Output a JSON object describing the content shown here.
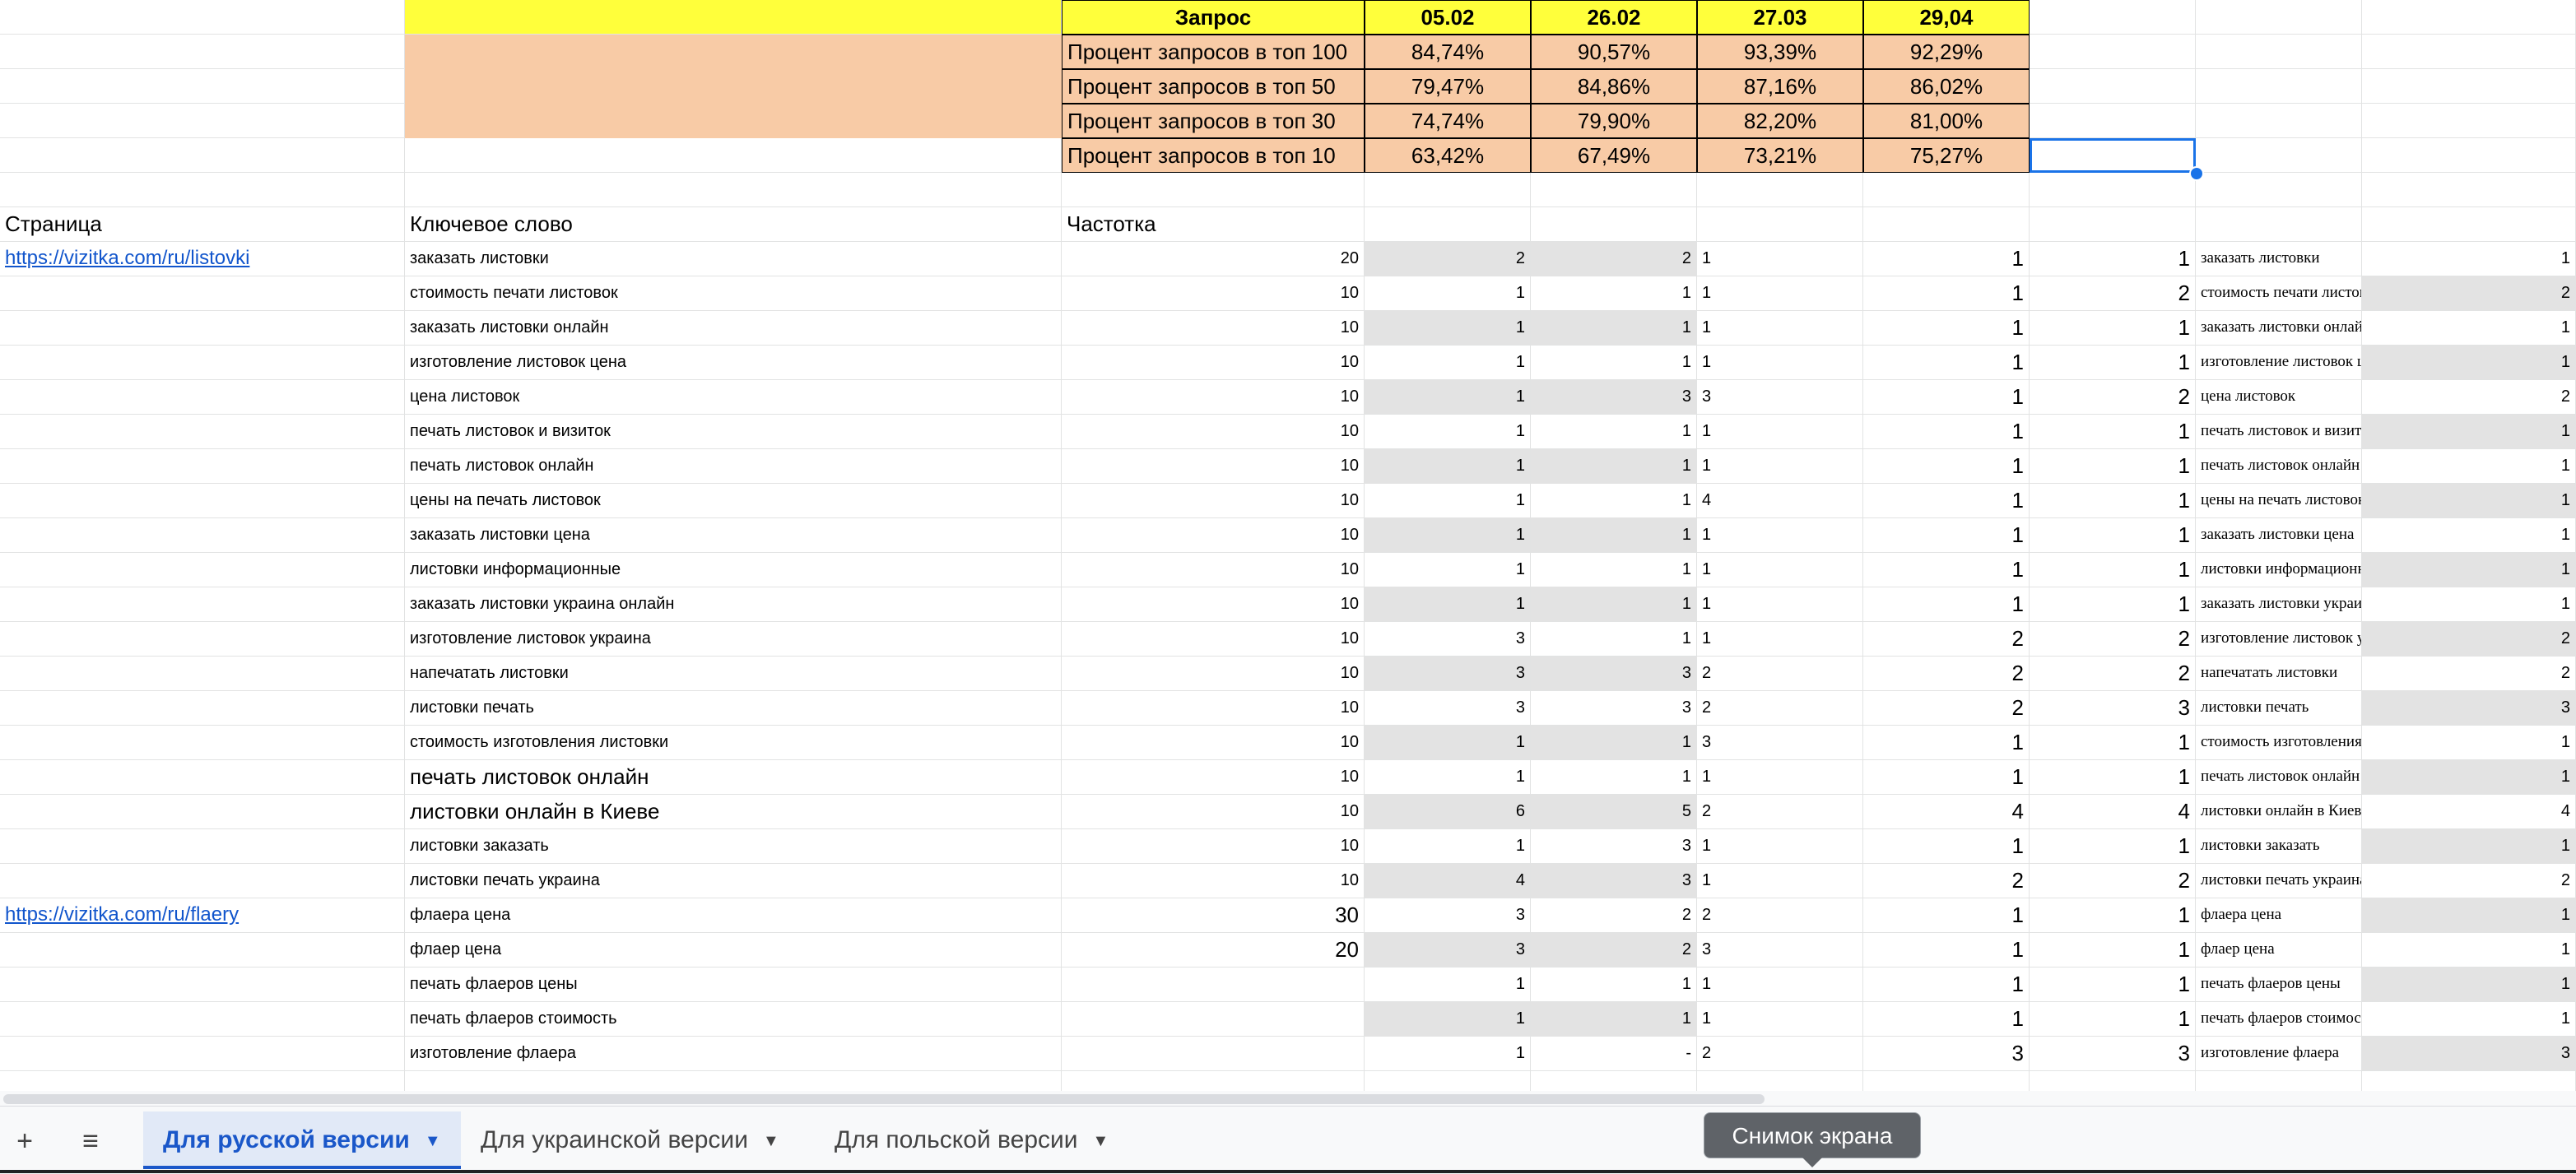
{
  "summary": {
    "header_label": "Запрос",
    "dates": [
      "05.02",
      "26.02",
      "27.03",
      "29,04"
    ],
    "rows": [
      {
        "label": "Процент запросов в топ 100",
        "values": [
          "84,74%",
          "90,57%",
          "93,39%",
          "92,29%"
        ]
      },
      {
        "label": "Процент запросов в топ 50",
        "values": [
          "79,47%",
          "84,86%",
          "87,16%",
          "86,02%"
        ]
      },
      {
        "label": "Процент запросов в топ 30",
        "values": [
          "74,74%",
          "79,90%",
          "82,20%",
          "81,00%"
        ]
      },
      {
        "label": "Процент запросов в топ 10",
        "values": [
          "63,42%",
          "67,49%",
          "73,21%",
          "75,27%"
        ]
      }
    ]
  },
  "columns": {
    "page": "Страница",
    "keyword": "Ключевое слово",
    "frequency": "Частотка"
  },
  "rows": [
    {
      "page": "https://vizitka.com/ru/listovki",
      "kw": "заказать листовки",
      "freq": "20",
      "d1": "2",
      "d2": "2",
      "d3": "1",
      "d4": "1",
      "e": "1",
      "kw2": "заказать листовки",
      "v2": "1"
    },
    {
      "page": "",
      "kw": "стоимость печати листовок",
      "freq": "10",
      "d1": "1",
      "d2": "1",
      "d3": "1",
      "d4": "1",
      "e": "2",
      "kw2": "стоимость печати листовок",
      "v2": "2"
    },
    {
      "page": "",
      "kw": "заказать листовки онлайн",
      "freq": "10",
      "d1": "1",
      "d2": "1",
      "d3": "1",
      "d4": "1",
      "e": "1",
      "kw2": "заказать листовки онлайн",
      "v2": "1"
    },
    {
      "page": "",
      "kw": "изготовление листовок цена",
      "freq": "10",
      "d1": "1",
      "d2": "1",
      "d3": "1",
      "d4": "1",
      "e": "1",
      "kw2": "изготовление листовок цена",
      "v2": "1"
    },
    {
      "page": "",
      "kw": "цена листовок",
      "freq": "10",
      "d1": "1",
      "d2": "3",
      "d3": "3",
      "d4": "1",
      "e": "2",
      "kw2": "цена листовок",
      "v2": "2"
    },
    {
      "page": "",
      "kw": "печать листовок и визиток",
      "freq": "10",
      "d1": "1",
      "d2": "1",
      "d3": "1",
      "d4": "1",
      "e": "1",
      "kw2": "печать листовок и визиток",
      "v2": "1"
    },
    {
      "page": "",
      "kw": "печать листовок онлайн",
      "freq": "10",
      "d1": "1",
      "d2": "1",
      "d3": "1",
      "d4": "1",
      "e": "1",
      "kw2": "печать листовок онлайн",
      "v2": "1"
    },
    {
      "page": "",
      "kw": "цены на печать листовок",
      "freq": "10",
      "d1": "1",
      "d2": "1",
      "d3": "4",
      "d4": "1",
      "e": "1",
      "kw2": "цены на печать листовок",
      "v2": "1"
    },
    {
      "page": "",
      "kw": "заказать листовки цена",
      "freq": "10",
      "d1": "1",
      "d2": "1",
      "d3": "1",
      "d4": "1",
      "e": "1",
      "kw2": "заказать листовки цена",
      "v2": "1"
    },
    {
      "page": "",
      "kw": "листовки информационные",
      "freq": "10",
      "d1": "1",
      "d2": "1",
      "d3": "1",
      "d4": "1",
      "e": "1",
      "kw2": "листовки информационные",
      "v2": "1"
    },
    {
      "page": "",
      "kw": "заказать листовки украина онлайн",
      "freq": "10",
      "d1": "1",
      "d2": "1",
      "d3": "1",
      "d4": "1",
      "e": "1",
      "kw2": "заказать листовки украина онлайн",
      "v2": "1"
    },
    {
      "page": "",
      "kw": "изготовление листовок украина",
      "freq": "10",
      "d1": "3",
      "d2": "1",
      "d3": "1",
      "d4": "2",
      "e": "2",
      "kw2": "изготовление листовок украина",
      "v2": "2"
    },
    {
      "page": "",
      "kw": "напечатать листовки",
      "freq": "10",
      "d1": "3",
      "d2": "3",
      "d3": "2",
      "d4": "2",
      "e": "2",
      "kw2": "напечатать листовки",
      "v2": "2"
    },
    {
      "page": "",
      "kw": "листовки печать",
      "freq": "10",
      "d1": "3",
      "d2": "3",
      "d3": "2",
      "d4": "2",
      "e": "3",
      "kw2": "листовки печать",
      "v2": "3"
    },
    {
      "page": "",
      "kw": "стоимость изготовления листовки",
      "freq": "10",
      "d1": "1",
      "d2": "1",
      "d3": "3",
      "d4": "1",
      "e": "1",
      "kw2": "стоимость изготовления листовки",
      "v2": "1"
    },
    {
      "page": "",
      "kw": "печать листовок онлайн",
      "freq": "10",
      "d1": "1",
      "d2": "1",
      "d3": "1",
      "d4": "1",
      "e": "1",
      "kw2": "печать листовок онлайн",
      "v2": "1"
    },
    {
      "page": "",
      "kw": "листовки онлайн в Киеве",
      "freq": "10",
      "d1": "6",
      "d2": "5",
      "d3": "2",
      "d4": "4",
      "e": "4",
      "kw2": "листовки онлайн в Киеве",
      "v2": "4"
    },
    {
      "page": "",
      "kw": "листовки заказать",
      "freq": "10",
      "d1": "1",
      "d2": "3",
      "d3": "1",
      "d4": "1",
      "e": "1",
      "kw2": "листовки заказать",
      "v2": "1"
    },
    {
      "page": "",
      "kw": "листовки печать украина",
      "freq": "10",
      "d1": "4",
      "d2": "3",
      "d3": "1",
      "d4": "2",
      "e": "2",
      "kw2": "листовки печать украина",
      "v2": "2"
    },
    {
      "page": "https://vizitka.com/ru/flaery",
      "kw": "флаера цена",
      "freq": "30",
      "d1": "3",
      "d2": "2",
      "d3": "2",
      "d4": "1",
      "e": "1",
      "kw2": "флаера цена",
      "v2": "1"
    },
    {
      "page": "",
      "kw": "флаер цена",
      "freq": "20",
      "d1": "3",
      "d2": "2",
      "d3": "3",
      "d4": "1",
      "e": "1",
      "kw2": "флаер цена",
      "v2": "1"
    },
    {
      "page": "",
      "kw": "печать флаеров цены",
      "freq": "",
      "d1": "1",
      "d2": "1",
      "d3": "1",
      "d4": "1",
      "e": "1",
      "kw2": "печать флаеров цены",
      "v2": "1"
    },
    {
      "page": "",
      "kw": "печать флаеров стоимость",
      "freq": "",
      "d1": "1",
      "d2": "1",
      "d3": "1",
      "d4": "1",
      "e": "1",
      "kw2": "печать флаеров стоимость",
      "v2": "1"
    },
    {
      "page": "",
      "kw": "изготовление флаера",
      "freq": "",
      "d1": "1",
      "d2": "-",
      "d3": "2",
      "d4": "3",
      "e": "3",
      "kw2": "изготовление флаера",
      "v2": "3"
    }
  ],
  "tabs": [
    {
      "label": "Для русской версии"
    },
    {
      "label": "Для украинской версии"
    },
    {
      "label": "Для польской версии"
    }
  ],
  "tooltip": "Снимок экрана",
  "icons": {
    "add": "plus-icon",
    "all_sheets": "menu-icon",
    "caret": "caret-down-icon"
  },
  "colors": {
    "header_yellow": "#ffff3b",
    "header_orange": "#f8cba6",
    "gray_cell": "#e3e3e3",
    "link": "#1155cc",
    "selection": "#1a73e8"
  }
}
